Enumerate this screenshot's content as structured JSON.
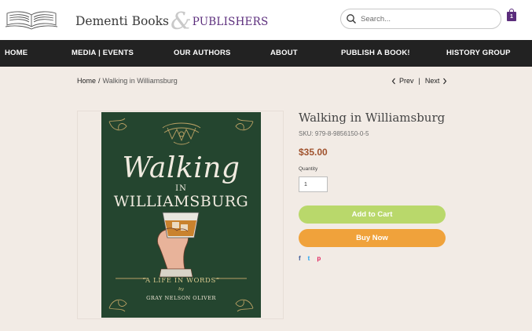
{
  "header": {
    "brand_name": "Dementi Books",
    "brand_amp": "&",
    "brand_publishers": "PUBLISHERS",
    "search_placeholder": "Search...",
    "cart_count": "1"
  },
  "nav": {
    "items": [
      "HOME",
      "MEDIA | EVENTS",
      "OUR AUTHORS",
      "ABOUT",
      "PUBLISH A BOOK!",
      "HISTORY GROUP"
    ]
  },
  "breadcrumb": {
    "home": "Home",
    "separator": "/",
    "current": "Walking in Williamsburg"
  },
  "pager": {
    "prev": "Prev",
    "divider": "|",
    "next": "Next"
  },
  "cover": {
    "title_line1": "Walking",
    "title_in": "IN",
    "title_line2": "WILLIAMSBURG",
    "tagline": "“A LIFE IN WORDS”",
    "by": "by",
    "author": "GRAY NELSON OLIVER"
  },
  "product": {
    "title": "Walking in Williamsburg",
    "sku": "SKU: 979-8-9856150-0-5",
    "price": "$35.00",
    "quantity_label": "Quantity",
    "quantity_value": "1",
    "add_to_cart": "Add to Cart",
    "buy_now": "Buy Now"
  },
  "share": {
    "facebook": "f",
    "twitter": "t",
    "pinterest": "p"
  },
  "colors": {
    "nav_bg": "#222222",
    "page_bg": "#f2ebe5",
    "brand_purple": "#5b2d7c",
    "price": "#a0522d",
    "add_to_cart_bg": "#b9d86b",
    "buy_now_bg": "#f0a23b",
    "cover_bg": "#24452f",
    "facebook": "#3b5998",
    "twitter": "#1da1f2",
    "pinterest": "#e0245e"
  }
}
